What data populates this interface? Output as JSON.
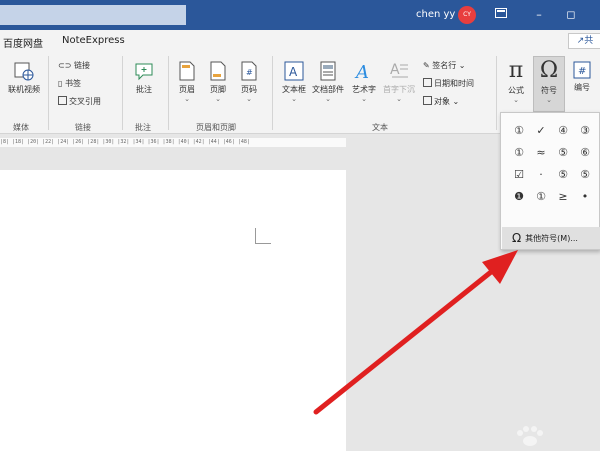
{
  "titlebar": {
    "user_name": "chen yy",
    "avatar_initials": "CY",
    "ribbon_display_icon": "ribbon-display-icon",
    "minimize_glyph": "–",
    "restore_glyph": "◻"
  },
  "tabs": {
    "baidu": "百度网盘",
    "noteexpress": "NoteExpress",
    "share": "共"
  },
  "ribbon": {
    "media": {
      "online_video": "联机视频",
      "group": "媒体"
    },
    "links": {
      "link": "链接",
      "bookmark": "书签",
      "cross_ref": "交叉引用",
      "group": "链接"
    },
    "comments": {
      "comment": "批注",
      "group": "批注"
    },
    "header_footer": {
      "header": "页眉",
      "footer": "页脚",
      "page_number": "页码",
      "group": "页眉和页脚"
    },
    "text": {
      "textbox": "文本框",
      "doc_parts": "文档部件",
      "wordart": "艺术字",
      "dropcap": "首字下沉",
      "signature_line": "签名行",
      "datetime": "日期和时间",
      "object": "对象",
      "group": "文本"
    },
    "symbols": {
      "equation": "公式",
      "symbol": "符号",
      "numbering": "编号"
    }
  },
  "ruler": {
    "ticks": "|8| |18| |20| |22| |24| |26| |28| |30| |32| |34| |36| |38| |40| |42| |44| |46| |48|"
  },
  "symbol_dropdown": {
    "symbols": [
      "①",
      "✓",
      "④",
      "③",
      "①",
      "≈",
      "⑤",
      "⑥",
      "☑",
      "·",
      "⑤",
      "⑤",
      "❶",
      "①",
      "≥",
      "•"
    ],
    "more_symbols": "其他符号(M)..."
  },
  "colors": {
    "titlebar": "#2b579a",
    "arrow": "#e02020",
    "avatar": "#e83e3e"
  }
}
